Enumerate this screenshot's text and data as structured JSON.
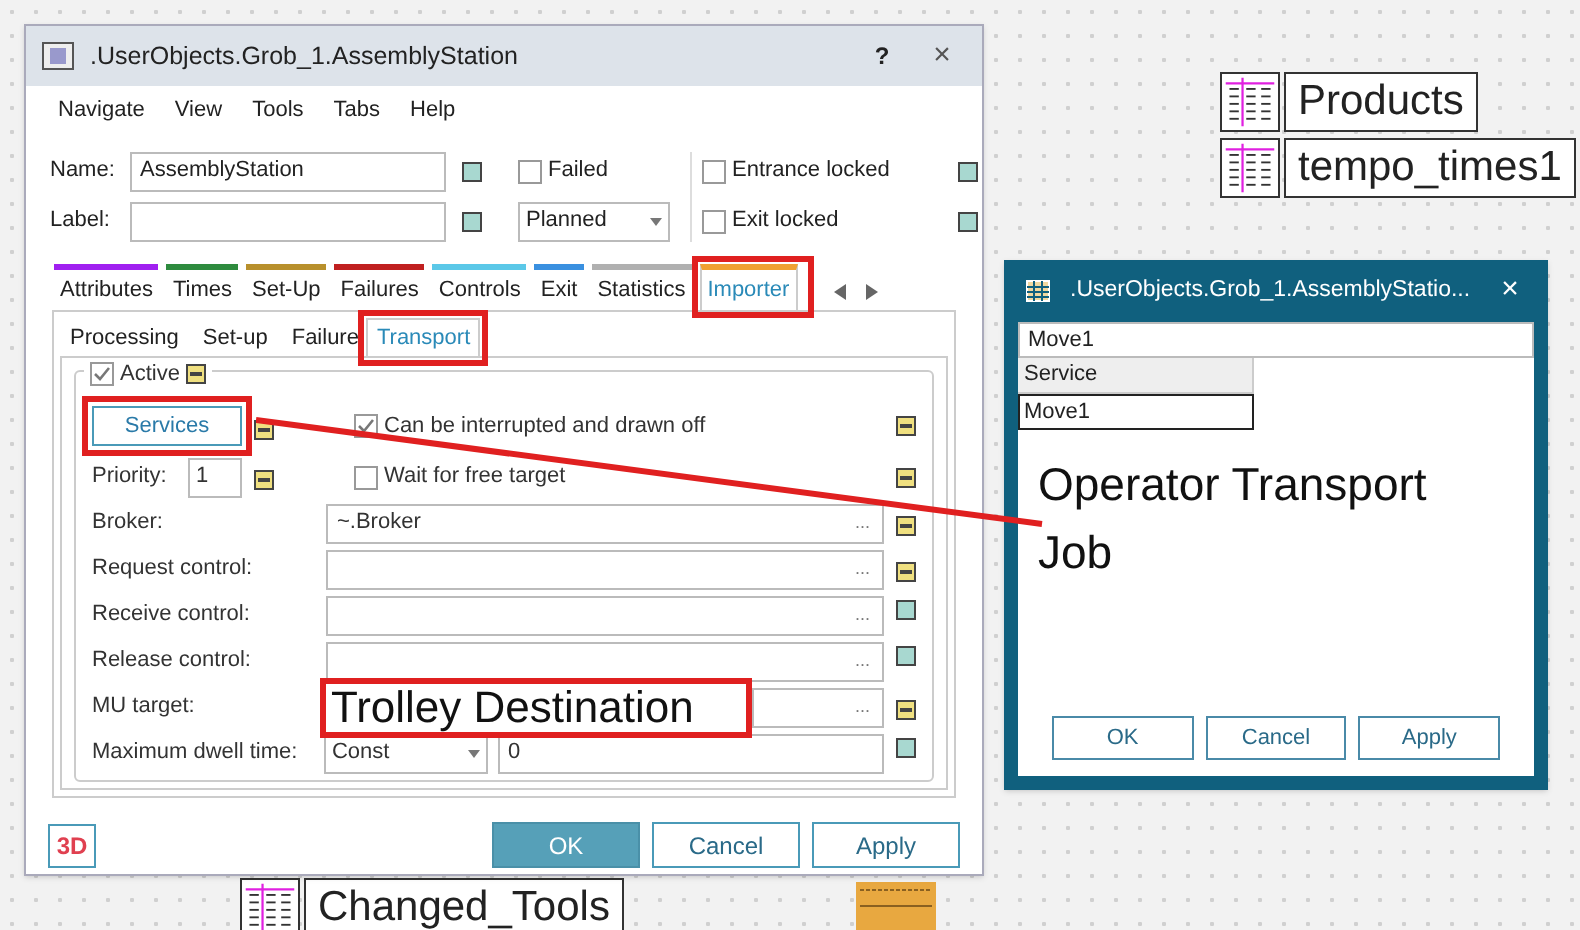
{
  "canvas": {
    "objects": [
      {
        "label": "Products"
      },
      {
        "label": "tempo_times1"
      },
      {
        "label": "Changed_Tools"
      }
    ]
  },
  "main_dialog": {
    "title": ".UserObjects.Grob_1.AssemblyStation",
    "help": "?",
    "close": "×",
    "menu": [
      "Navigate",
      "View",
      "Tools",
      "Tabs",
      "Help"
    ],
    "name": {
      "label": "Name:",
      "value": "AssemblyStation",
      "color": "#a8d8d0"
    },
    "label_field": {
      "label": "Label:",
      "color": "#a8d8d0"
    },
    "failed": {
      "label": "Failed",
      "checked": false
    },
    "state_dropdown": {
      "value": "Planned"
    },
    "entrance_locked": {
      "label": "Entrance locked",
      "checked": false,
      "color": "#a8d8d0"
    },
    "exit_locked": {
      "label": "Exit locked",
      "checked": false,
      "color": "#a8d8d0"
    },
    "tabs": [
      {
        "label": "Attributes",
        "color": "#a020f0",
        "selected": false,
        "highlighted": false
      },
      {
        "label": "Times",
        "color": "#2e8b3e",
        "selected": false,
        "highlighted": false
      },
      {
        "label": "Set-Up",
        "color": "#b8902c",
        "selected": false,
        "highlighted": false
      },
      {
        "label": "Failures",
        "color": "#c02020",
        "selected": false,
        "highlighted": false
      },
      {
        "label": "Controls",
        "color": "#5bc8e8",
        "selected": false,
        "highlighted": false
      },
      {
        "label": "Exit",
        "color": "#3a90e0",
        "selected": false,
        "highlighted": false
      },
      {
        "label": "Statistics",
        "color": "#b0b0b0",
        "selected": false,
        "highlighted": false
      },
      {
        "label": "Importer",
        "color": "#f0a030",
        "selected": true,
        "highlighted": true
      }
    ],
    "subtabs": [
      {
        "label": "Processing",
        "selected": false,
        "highlighted": false
      },
      {
        "label": "Set-up",
        "selected": false,
        "highlighted": false
      },
      {
        "label": "Failure",
        "selected": false,
        "highlighted": false
      },
      {
        "label": "Transport",
        "selected": true,
        "highlighted": true
      }
    ],
    "active": {
      "label": "Active",
      "checked": true,
      "color": "#f0e080"
    },
    "services_button": {
      "label": "Services",
      "color": "#f0e080",
      "highlighted": true
    },
    "options": [
      {
        "label": "Can be interrupted and drawn off",
        "checked": true,
        "color": "#f0e080"
      },
      {
        "label": "Wait for free target",
        "checked": false,
        "color": "#f0e080"
      }
    ],
    "priority": {
      "label": "Priority:",
      "value": "1",
      "color": "#f0e080"
    },
    "fields": [
      {
        "label": "Broker:",
        "value": "~.Broker",
        "button": "...",
        "color": "#f0e080"
      },
      {
        "label": "Request control:",
        "button": "...",
        "color": "#f0e080"
      },
      {
        "label": "Receive control:",
        "button": "...",
        "color": "#a8d8d0"
      },
      {
        "label": "Release control:",
        "button": "...",
        "color": "#a8d8d0"
      },
      {
        "label": "MU target:",
        "button": "...",
        "color": "#f0e080",
        "annotation": "Trolley Destination"
      }
    ],
    "dwell": {
      "label": "Maximum dwell time:",
      "distribution": "Const",
      "value": "0",
      "color": "#a8d8d0"
    },
    "badge_3d": "3D",
    "buttons": [
      {
        "label": "OK",
        "selected": true
      },
      {
        "label": "Cancel",
        "selected": false
      },
      {
        "label": "Apply",
        "selected": false
      }
    ]
  },
  "services_dialog": {
    "title": ".UserObjects.Grob_1.AssemblyStatio...",
    "close": "×",
    "field": "Move1",
    "table": {
      "columns": [
        "Service"
      ],
      "rows": [
        [
          "Move1"
        ]
      ]
    },
    "annotation": "Operator Transport Job",
    "buttons": [
      "OK",
      "Cancel",
      "Apply"
    ]
  }
}
